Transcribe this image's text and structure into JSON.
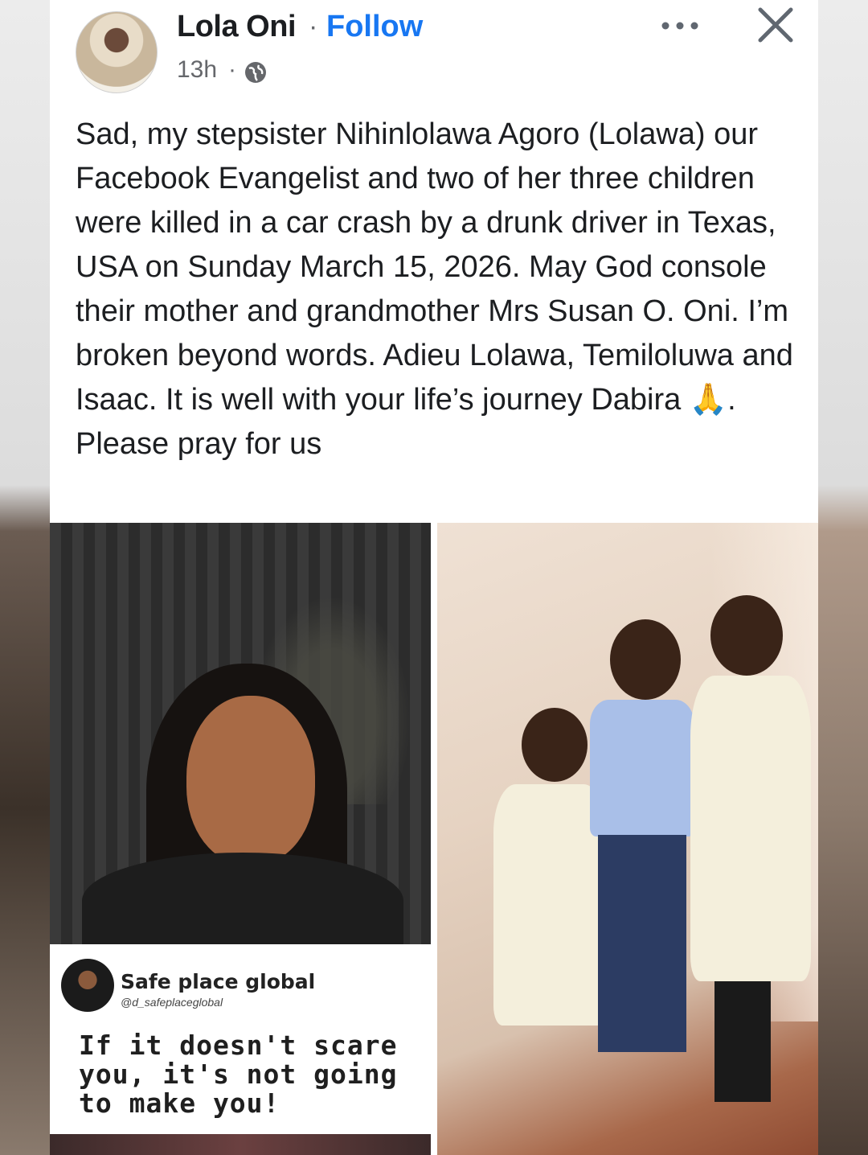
{
  "post": {
    "author": "Lola Oni",
    "separator": "·",
    "follow_label": "Follow",
    "time": "13h",
    "time_separator": "·",
    "audience_icon": "globe-icon",
    "more_icon": "more-options-icon",
    "close_icon": "close-icon",
    "text": "Sad, my stepsister Nihinlolawa Agoro (Lolawa) our Facebook Evangelist and two of her three children were killed in a car crash by a drunk driver in Texas, USA on Sunday March 15, 2026. May God console their mother and grandmother Mrs Susan O. Oni. I’m broken beyond words. Adieu Lolawa, Temiloluwa and Isaac. It is well with your life’s journey Dabira 🙏. Please pray for us"
  },
  "photos": {
    "left_quote": {
      "brand": "Safe place global",
      "handle": "@d_safeplaceglobal",
      "quote": "If it doesn't scare you, it's not going to make you!"
    }
  },
  "colors": {
    "link": "#1877f2",
    "text": "#1c1e21",
    "meta": "#65676b"
  }
}
